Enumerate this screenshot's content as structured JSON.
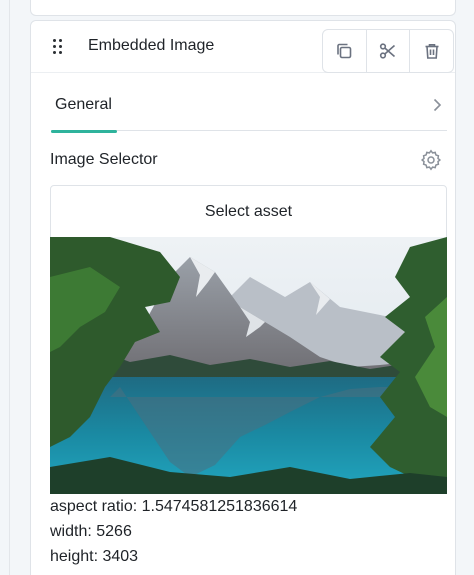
{
  "panel": {
    "title": "Embedded Image",
    "actions": [
      {
        "name": "duplicate-icon"
      },
      {
        "name": "scissors-icon"
      },
      {
        "name": "trash-icon"
      }
    ]
  },
  "tabs": {
    "general_label": "General"
  },
  "image_selector": {
    "title": "Image Selector",
    "button_label": "Select asset",
    "preview_alt": "mountain lake landscape"
  },
  "metadata": {
    "aspect_ratio": "aspect ratio: 1.5474581251836614",
    "width": "width: 5266",
    "height": "height: 3403"
  },
  "colors": {
    "accent": "#2eb39c",
    "border": "#dfe3e8",
    "text": "#1f2328",
    "icon": "#6b7280"
  }
}
